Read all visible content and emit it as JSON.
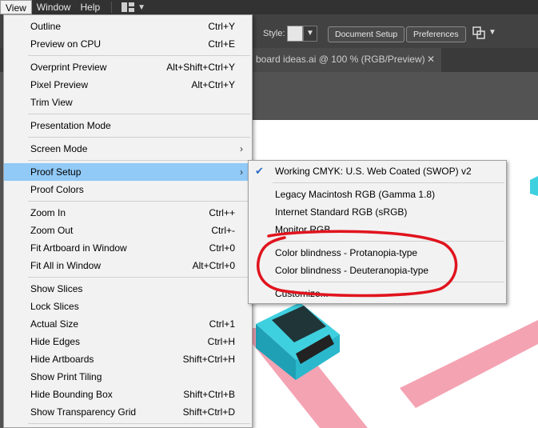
{
  "menubar": {
    "items": [
      "View",
      "Window",
      "Help"
    ]
  },
  "controlbar": {
    "style_label": "Style:",
    "document_setup": "Document Setup",
    "preferences": "Preferences"
  },
  "document_tab": {
    "title": "board ideas.ai @ 100 % (RGB/Preview)",
    "close": "✕"
  },
  "view_menu": {
    "items": [
      {
        "label": "Outline",
        "shortcut": "Ctrl+Y"
      },
      {
        "label": "Preview on CPU",
        "shortcut": "Ctrl+E"
      },
      {
        "label": "Overprint Preview",
        "shortcut": "Alt+Shift+Ctrl+Y"
      },
      {
        "label": "Pixel Preview",
        "shortcut": "Alt+Ctrl+Y"
      },
      {
        "label": "Trim View",
        "shortcut": ""
      },
      {
        "label": "Presentation Mode",
        "shortcut": ""
      },
      {
        "label": "Screen Mode",
        "shortcut": "",
        "submenu": true
      },
      {
        "label": "Proof Setup",
        "shortcut": "",
        "submenu": true,
        "highlighted": true
      },
      {
        "label": "Proof Colors",
        "shortcut": ""
      },
      {
        "label": "Zoom In",
        "shortcut": "Ctrl++"
      },
      {
        "label": "Zoom Out",
        "shortcut": "Ctrl+-"
      },
      {
        "label": "Fit Artboard in Window",
        "shortcut": "Ctrl+0"
      },
      {
        "label": "Fit All in Window",
        "shortcut": "Alt+Ctrl+0"
      },
      {
        "label": "Show Slices",
        "shortcut": ""
      },
      {
        "label": "Lock Slices",
        "shortcut": ""
      },
      {
        "label": "Actual Size",
        "shortcut": "Ctrl+1"
      },
      {
        "label": "Hide Edges",
        "shortcut": "Ctrl+H"
      },
      {
        "label": "Hide Artboards",
        "shortcut": "Shift+Ctrl+H"
      },
      {
        "label": "Show Print Tiling",
        "shortcut": ""
      },
      {
        "label": "Hide Bounding Box",
        "shortcut": "Shift+Ctrl+B"
      },
      {
        "label": "Show Transparency Grid",
        "shortcut": "Shift+Ctrl+D"
      }
    ]
  },
  "proof_setup_menu": {
    "items": [
      {
        "label": "Working CMYK: U.S. Web Coated (SWOP) v2",
        "checked": true
      },
      {
        "label": "Legacy Macintosh RGB (Gamma 1.8)"
      },
      {
        "label": "Internet Standard RGB (sRGB)"
      },
      {
        "label": "Monitor RGB"
      },
      {
        "label": "Color blindness - Protanopia-type"
      },
      {
        "label": "Color blindness - Deuteranopia-type"
      },
      {
        "label": "Customize..."
      }
    ]
  },
  "colors": {
    "menu_highlight": "#91c9f7",
    "annotation": "#e0141e",
    "artwork_cyan": "#3fd0e0",
    "artwork_pink": "#f4a3b3"
  }
}
